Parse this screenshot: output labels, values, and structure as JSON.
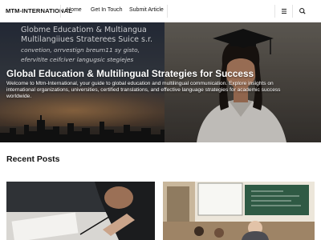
{
  "site": {
    "name": "MTM-INTERNATIONAL"
  },
  "nav": {
    "items": [
      {
        "label": "Home"
      },
      {
        "label": "Get In Touch"
      },
      {
        "label": "Submit Article"
      }
    ],
    "icons": {
      "menu": "menu-icon",
      "search": "search-icon"
    }
  },
  "hero": {
    "background_text": [
      "Globme Educatiom & Multiangua",
      "Multilangiiues Straterees Suice s.r.",
      "convetion, orrvestign breum11 sy gisto,",
      "efervitite ceifciver langugsic stegiejes"
    ],
    "title": "Global Education & Multilingual Strategies for Success",
    "description": "Welcome to Mtm-International, your guide to global education and multilingual communication. Explore insights on international organizations, universities, certified translations, and effective language strategies for academic success worldwide."
  },
  "recent_posts": {
    "title": "Recent Posts"
  }
}
